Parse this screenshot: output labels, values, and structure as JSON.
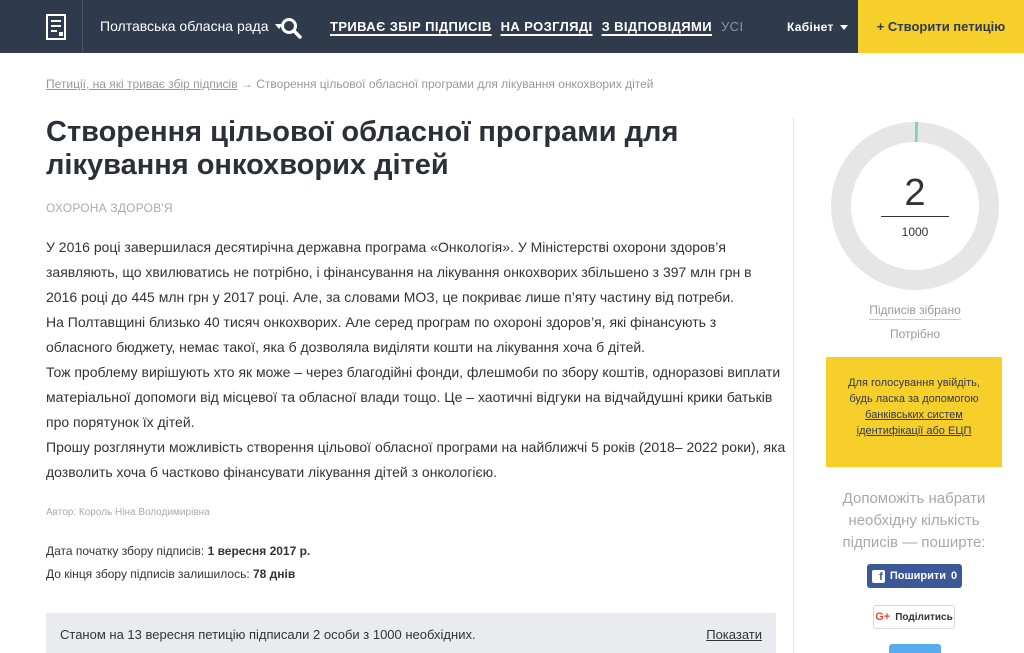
{
  "header": {
    "region": "Полтавська обласна рада",
    "nav": [
      {
        "label": "ТРИВАЄ ЗБІР ПІДПИСІВ"
      },
      {
        "label": "НА РОЗГЛЯДІ"
      },
      {
        "label": "З ВІДПОВІДЯМИ"
      },
      {
        "label": "УСІ"
      }
    ],
    "cabinet": "Кабінет",
    "create_button": "+ Створити петицію"
  },
  "breadcrumb": {
    "parent": "Петиції, на які триває збір підписів",
    "separator": " → ",
    "current": "Створення цільової обласної програми для лікування онкохворих дітей"
  },
  "petition": {
    "title": "Створення цільової обласної програми для лікування онкохворих дітей",
    "category": "ОХОРОНА ЗДОРОВ'Я",
    "paragraphs": [
      "У 2016 році завершилася десятирічна державна програма «Онкологія». У Міністерстві охорони здоров’я заявляють, що хвилюватись не потрібно, і фінансування на лікування онкохворих збільшено з 397 млн грн в 2016 році до 445 млн грн у 2017 році. Але, за словами МОЗ, це покриває лише п’яту частину від потреби.",
      "На Полтавщині близько 40 тисяч онкохворих. Але серед програм по охороні здоров’я, які фінансують з обласного бюджету, немає такої, яка б дозволяла виділяти кошти на лікування хоча б дітей.",
      "Тож проблему вирішують хто як може – через благодійні фонди, флешмоби по збору коштів, одноразові виплати матеріальної допомоги від місцевої та обласної влади тощо. Це – хаотичні відгуки на відчайдушні крики батьків про порятунок їх дітей.",
      "Прошу розглянути можливість створення цільової обласної програми на найближчі 5 років (2018– 2022 роки), яка дозволить хоча б частково фінансувати лікування дітей з онкологією."
    ],
    "author": "Автор: Король Ніна Володимирівна",
    "start_label": "Дата початку збору підписів: ",
    "start_value": "1 вересня 2017 р.",
    "remaining_label": "До кінця збору підписів залишилось: ",
    "remaining_value": "78 днів",
    "status_text": "Станом на 13 вересня петицію підписали 2 особи з 1000 необхідних.",
    "show_link": "Показати"
  },
  "sidebar": {
    "signatures": 2,
    "target": 1000,
    "signatures_label": "2",
    "target_label": "1000",
    "collected_label": "Підписів зібрано",
    "needed_label": "Потрібно",
    "vote_text_1": "Для голосування увійдіть, будь ласка за допомогою ",
    "vote_link": "банківських систем ідентифікації або ЕЦП",
    "help_text": "Допоможіть набрати необхідну кількість підписів — поширте:",
    "fb_label": "Поширити",
    "fb_count": "0",
    "gp_label": "Поділитись"
  },
  "colors": {
    "header_bg": "#2f3a4d",
    "accent_yellow": "#f6cf2a",
    "ring_track": "#e6e6e6",
    "ring_progress": "#7dd3b8",
    "facebook": "#3b5998",
    "twitter": "#55acee"
  }
}
